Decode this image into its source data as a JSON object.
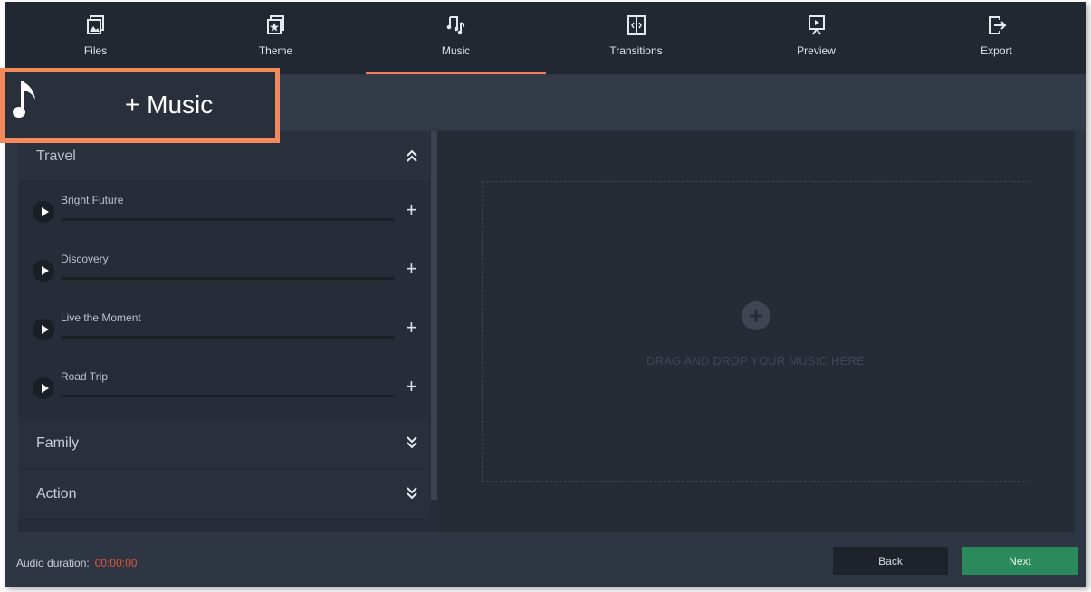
{
  "tabs": [
    {
      "label": "Files",
      "icon": "files-icon"
    },
    {
      "label": "Theme",
      "icon": "theme-icon"
    },
    {
      "label": "Music",
      "icon": "music-icon",
      "active": true
    },
    {
      "label": "Transitions",
      "icon": "transitions-icon"
    },
    {
      "label": "Preview",
      "icon": "preview-icon"
    },
    {
      "label": "Export",
      "icon": "export-icon"
    }
  ],
  "callout": {
    "label": "+ Music",
    "icon": "music-note-icon"
  },
  "library": {
    "groups": [
      {
        "name": "Travel",
        "expanded": true,
        "tracks": [
          {
            "name": "Bright Future"
          },
          {
            "name": "Discovery"
          },
          {
            "name": "Live the Moment"
          },
          {
            "name": "Road Trip"
          }
        ]
      },
      {
        "name": "Family",
        "expanded": false
      },
      {
        "name": "Action",
        "expanded": false
      }
    ]
  },
  "dropzone": {
    "text": "DRAG AND DROP YOUR MUSIC HERE",
    "plus": "+"
  },
  "footer": {
    "duration_label": "Audio duration:",
    "duration_value": "00:00:00",
    "back_label": "Back",
    "next_label": "Next"
  },
  "colors": {
    "accent": "#f27e5a",
    "next": "#2b8a5b",
    "duration": "#e2543a"
  }
}
